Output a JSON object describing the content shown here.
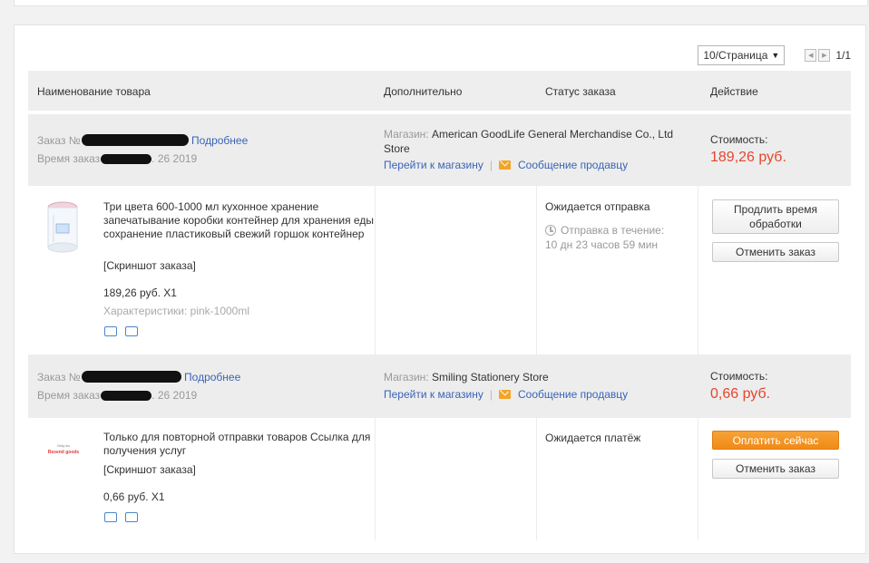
{
  "pager": {
    "per_page": "10/Страница",
    "prev_icon": "arrow-left-icon",
    "next_icon": "arrow-right-icon",
    "count": "1/1"
  },
  "columns": {
    "product": "Наименование товара",
    "extra": "Дополнительно",
    "status": "Статус заказа",
    "action": "Действие"
  },
  "orders": [
    {
      "order_label": "Заказ №",
      "details_link": "Подробнее",
      "time_label": "Время заказ",
      "time_tail": ". 26 2019",
      "store_label": "Магазин:",
      "store_name": "American GoodLife General Merchandise Co., Ltd Store",
      "go_to_store": "Перейти к магазину",
      "message_seller": "Сообщение продавцу",
      "cost_label": "Стоимость:",
      "cost_value": "189,26 руб.",
      "product_title": "Три цвета 600-1000 мл кухонное хранение запечатывание коробки контейнер для хранения еды сохранение пластиковый свежий горшок контейнер",
      "screenshot_link": "[Скриншот заказа]",
      "price_qty": "189,26 руб. X1",
      "attributes": "Характеристики: pink-1000ml",
      "status": "Ожидается отправка",
      "countdown_label": "Отправка в течение:",
      "countdown_value": "10 дн 23 часов 59 мин",
      "primary_button": "Продлить время обработки",
      "cancel_button": "Отменить заказ"
    },
    {
      "order_label": "Заказ №",
      "details_link": "Подробнее",
      "time_label": "Время заказ",
      "time_tail": ". 26 2019",
      "store_label": "Магазин:",
      "store_name": "Smiling Stationery Store",
      "go_to_store": "Перейти к магазину",
      "message_seller": "Сообщение продавцу",
      "cost_label": "Стоимость:",
      "cost_value": "0,66 руб.",
      "product_title": "Только для повторной отправки товаров Ссылка для получения услуг",
      "screenshot_link": "[Скриншот заказа]",
      "price_qty": "0,66 руб. X1",
      "thumb_text_1": "Only for",
      "thumb_text_2": "Resend goods",
      "status": "Ожидается платёж",
      "primary_button": "Оплатить сейчас",
      "cancel_button": "Отменить заказ"
    }
  ],
  "colors": {
    "accent_link": "#3a64b5",
    "price_red": "#e8452c",
    "pay_orange": "#f08a16"
  }
}
